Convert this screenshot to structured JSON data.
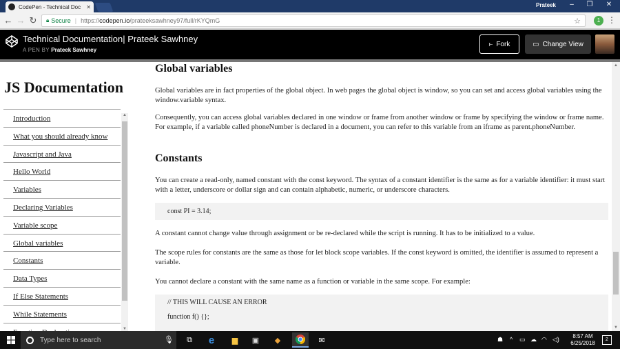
{
  "browser": {
    "tab_title": "CodePen - Technical Doc",
    "tab_close": "✕",
    "profile": "Prateek",
    "secure_label": "Secure",
    "url_proto": "https://",
    "url_host": "codepen.io",
    "url_path": "/prateeksawhney97/full/rKYQmG"
  },
  "codepen": {
    "title": "Technical Documentation| Prateek Sawhney",
    "by_label": "A PEN BY",
    "author": "Prateek Sawhney",
    "fork_label": "Fork",
    "change_view_label": "Change View"
  },
  "sidebar": {
    "title": "JS Documentation",
    "items": [
      {
        "label": "Introduction"
      },
      {
        "label": "What you should already know"
      },
      {
        "label": "Javascript and Java"
      },
      {
        "label": "Hello World"
      },
      {
        "label": "Variables"
      },
      {
        "label": "Declaring Variables"
      },
      {
        "label": "Variable scope"
      },
      {
        "label": "Global variables"
      },
      {
        "label": "Constants"
      },
      {
        "label": "Data Types"
      },
      {
        "label": "If Else Statements"
      },
      {
        "label": "While Statements"
      },
      {
        "label": "Function Declarations"
      }
    ]
  },
  "main": {
    "global_heading": "Global variables",
    "global_p1": "Global variables are in fact properties of the global object. In web pages the global object is window, so you can set and access global variables using the window.variable syntax.",
    "global_p2": "Consequently, you can access global variables declared in one window or frame from another window or frame by specifying the window or frame name. For example, if a variable called phoneNumber is declared in a document, you can refer to this variable from an iframe as parent.phoneNumber.",
    "constants_heading": "Constants",
    "constants_p1": "You can create a read-only, named constant with the const keyword. The syntax of a constant identifier is the same as for a variable identifier: it must start with a letter, underscore or dollar sign and can contain alphabetic, numeric, or underscore characters.",
    "code1": "const PI = 3.14;",
    "constants_p2": "A constant cannot change value through assignment or be re-declared while the script is running. It has to be initialized to a value.",
    "constants_p3": "The scope rules for constants are the same as those for let block scope variables. If the const keyword is omitted, the identifier is assumed to represent a variable.",
    "constants_p4": "You cannot declare a constant with the same name as a function or variable in the same scope. For example:",
    "code2_line1": "// THIS WILL CAUSE AN ERROR",
    "code2_line2": "function f() {};"
  },
  "taskbar": {
    "search_placeholder": "Type here to search",
    "time": "8:57 AM",
    "date": "6/25/2018",
    "notification_count": "2"
  }
}
